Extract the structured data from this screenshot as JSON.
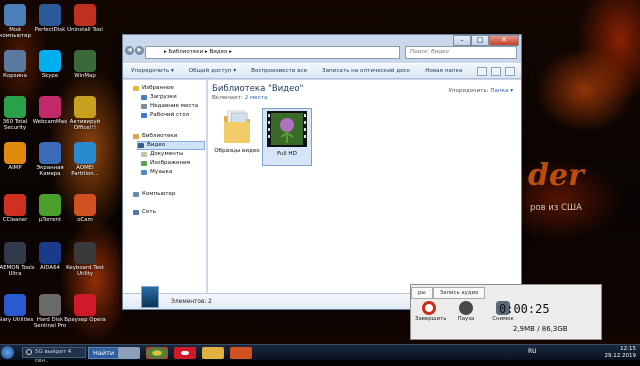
{
  "desktop": {
    "icons": [
      {
        "label": "Мой компьютер",
        "icon": "computer-icon",
        "color": "#4a7fb8"
      },
      {
        "label": "PerfectDisk",
        "icon": "disk-icon",
        "color": "#2a5a9a"
      },
      {
        "label": "Uninstall Tool",
        "icon": "uninstall-icon",
        "color": "#c03020"
      },
      {
        "label": "Корзина",
        "icon": "recycle-bin-icon",
        "color": "#5a7aa0"
      },
      {
        "label": "Skype",
        "icon": "skype-icon",
        "color": "#00aff0"
      },
      {
        "label": "WinMap",
        "icon": "winmap-icon",
        "color": "#3a6a3a"
      },
      {
        "label": "360 Total Security",
        "icon": "shield-icon",
        "color": "#2aa04a"
      },
      {
        "label": "WebcamMax",
        "icon": "webcam-icon",
        "color": "#c02a6a"
      },
      {
        "label": "Активируй Office!!!",
        "icon": "office-icon",
        "color": "#c8a020"
      },
      {
        "label": "AIMP",
        "icon": "aimp-icon",
        "color": "#e08a10"
      },
      {
        "label": "Экранная Камера",
        "icon": "camera-icon",
        "color": "#3a6ab8"
      },
      {
        "label": "AOMEI Partition...",
        "icon": "partition-icon",
        "color": "#2a8ad0"
      },
      {
        "label": "CCleaner",
        "icon": "ccleaner-icon",
        "color": "#d03020"
      },
      {
        "label": "µTorrent",
        "icon": "torrent-icon",
        "color": "#4aa02a"
      },
      {
        "label": "oCam",
        "icon": "ocam-icon",
        "color": "#d05020"
      },
      {
        "label": "DAEMON Tools Ultra",
        "icon": "daemon-icon",
        "color": "#303a4a"
      },
      {
        "label": "AIDA64",
        "icon": "aida-icon",
        "color": "#1a3a8a"
      },
      {
        "label": "Keyboard Test Utility",
        "icon": "keyboard-icon",
        "color": "#3a3a3a"
      },
      {
        "label": "Glary Utilities",
        "icon": "glary-icon",
        "color": "#2a5ad0"
      },
      {
        "label": "Hard Disk Sentinel Pro",
        "icon": "harddisk-icon",
        "color": "#6a6a6a"
      },
      {
        "label": "Браузер Opera",
        "icon": "opera-icon",
        "color": "#d01a2a"
      }
    ],
    "brand_text": "der",
    "brand_tagline": "ров из США"
  },
  "explorer": {
    "breadcrumb": "▸ Библиотеки ▸ Видео ▸",
    "search_placeholder": "Поиск: Видео",
    "toolbar": [
      "Упорядочить ▾",
      "Общий доступ ▾",
      "Воспроизвести все",
      "Записать на оптический диск",
      "Новая папка"
    ],
    "nav": {
      "favorites": "Избранное",
      "downloads": "Загрузки",
      "recent": "Недавние места",
      "desktop": "Рабочий стол",
      "libraries": "Библиотеки",
      "video": "Видео",
      "documents": "Документы",
      "images": "Изображения",
      "music": "Музыка",
      "computer": "Компьютер",
      "network": "Сеть"
    },
    "library_title": "Библиотека \"Видео\"",
    "includes_label": "Включает:",
    "includes_link": "2 места",
    "arrange_label": "Упорядочить:",
    "arrange_value": "Папка ▾",
    "items": [
      {
        "label": "Образцы видео",
        "icon": "folder-icon"
      },
      {
        "label": "Full HD",
        "icon": "video-thumbnail-icon"
      }
    ],
    "status": "Элементов: 2"
  },
  "recorder": {
    "tab1": "ры",
    "tab2": "Запись аудио",
    "time": "0:00:25",
    "buttons": [
      "Завершить",
      "Пауза",
      "Снимок"
    ],
    "size": "2,9MB / 86,3GB"
  },
  "taskbar": {
    "search_text": "5G выйдет 4 сен..",
    "web_label": "Найти",
    "lang": "RU",
    "time": "12:15",
    "date": "29.12.2019"
  },
  "colors": {
    "accent": "#2c63b5",
    "title": "#1e395b",
    "rec_red": "#d02a1a"
  }
}
